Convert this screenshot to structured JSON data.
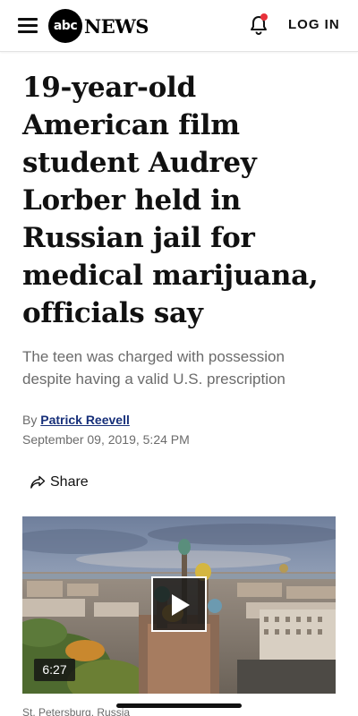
{
  "header": {
    "logo_mark": "abc",
    "logo_word": "NEWS",
    "login_label": "LOG IN",
    "notification_dot_color": "#e8313a"
  },
  "article": {
    "headline": "19-year-old American film student Audrey Lorber held in Russian jail for medical marijuana, officials say",
    "subheadline": "The teen was charged with possession despite having a valid U.S. prescription",
    "byline_prefix": "By",
    "author": "Patrick Reevell",
    "date": "September 09, 2019, 5:24 PM",
    "share_label": "Share"
  },
  "video": {
    "duration": "6:27",
    "caption": "St. Petersburg, Russia"
  },
  "icons": {
    "menu": "hamburger-icon",
    "notifications": "bell-icon",
    "share": "share-arrow-icon",
    "play": "play-icon"
  }
}
